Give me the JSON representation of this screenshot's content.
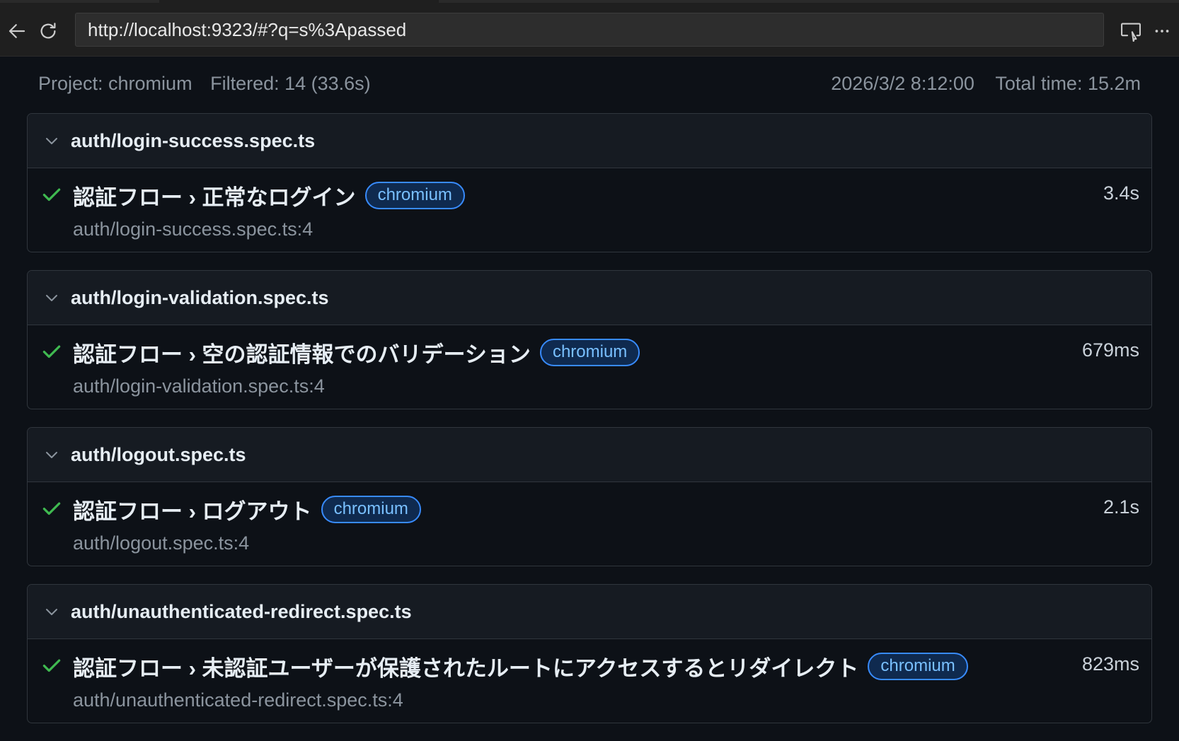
{
  "browser": {
    "url": "http://localhost:9323/#?q=s%3Apassed",
    "back_icon": "arrow-left-icon",
    "reload_icon": "reload-icon",
    "cast_icon": "cast-icon",
    "more_icon": "more-horizontal-icon"
  },
  "summary": {
    "project": "Project: chromium",
    "filtered": "Filtered: 14 (33.6s)",
    "datetime": "2026/3/2 8:12:00",
    "total_time": "Total time: 15.2m"
  },
  "colors": {
    "pass": "#3fb950",
    "badge_border": "#388bfd",
    "badge_text": "#79c0ff"
  },
  "files": [
    {
      "name": "auth/login-success.spec.ts",
      "tests": [
        {
          "title": "認証フロー › 正常なログイン",
          "project_badge": "chromium",
          "duration": "3.4s",
          "location": "auth/login-success.spec.ts:4",
          "status": "passed"
        }
      ]
    },
    {
      "name": "auth/login-validation.spec.ts",
      "tests": [
        {
          "title": "認証フロー › 空の認証情報でのバリデーション",
          "project_badge": "chromium",
          "duration": "679ms",
          "location": "auth/login-validation.spec.ts:4",
          "status": "passed"
        }
      ]
    },
    {
      "name": "auth/logout.spec.ts",
      "tests": [
        {
          "title": "認証フロー › ログアウト",
          "project_badge": "chromium",
          "duration": "2.1s",
          "location": "auth/logout.spec.ts:4",
          "status": "passed"
        }
      ]
    },
    {
      "name": "auth/unauthenticated-redirect.spec.ts",
      "tests": [
        {
          "title": "認証フロー › 未認証ユーザーが保護されたルートにアクセスするとリダイレクト",
          "project_badge": "chromium",
          "duration": "823ms",
          "location": "auth/unauthenticated-redirect.spec.ts:4",
          "status": "passed"
        }
      ]
    }
  ]
}
